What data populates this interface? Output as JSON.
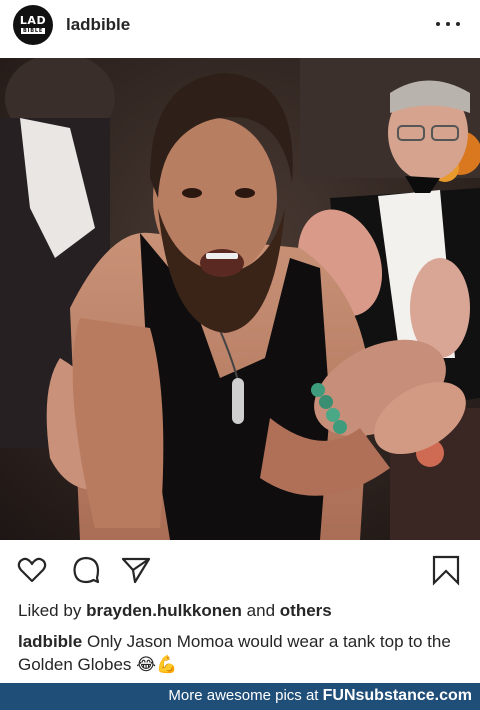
{
  "post": {
    "username": "ladbible",
    "avatar": {
      "top": "LAD",
      "bottom": "BIBLE"
    }
  },
  "icons": [
    "heart-icon",
    "comment-icon",
    "share-icon",
    "bookmark-icon",
    "more-icon"
  ],
  "likes": {
    "prefix": "Liked by",
    "user": "brayden.hulkkonen",
    "middle": "and",
    "others": "others"
  },
  "caption": {
    "author": "ladbible",
    "text": "Only Jason Momoa would wear a tank top to the Golden Globes 😂💪"
  },
  "footer": {
    "text": "More awesome pics at",
    "brand": "FUNsubstance.com",
    "background": "#1f4e79"
  }
}
